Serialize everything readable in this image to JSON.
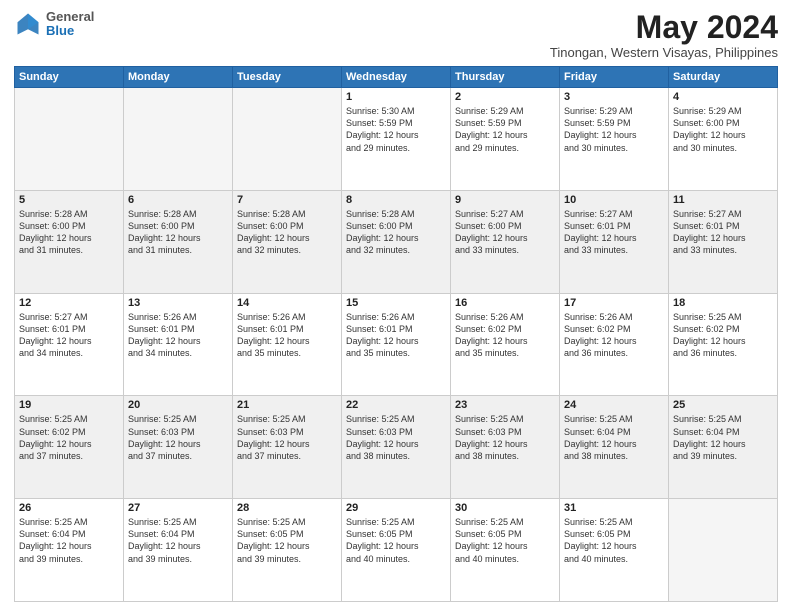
{
  "header": {
    "logo_line1": "General",
    "logo_line2": "Blue",
    "title": "May 2024",
    "subtitle": "Tinongan, Western Visayas, Philippines"
  },
  "columns": [
    "Sunday",
    "Monday",
    "Tuesday",
    "Wednesday",
    "Thursday",
    "Friday",
    "Saturday"
  ],
  "weeks": [
    {
      "shaded": false,
      "days": [
        {
          "num": "",
          "detail": ""
        },
        {
          "num": "",
          "detail": ""
        },
        {
          "num": "",
          "detail": ""
        },
        {
          "num": "1",
          "detail": "Sunrise: 5:30 AM\nSunset: 5:59 PM\nDaylight: 12 hours\nand 29 minutes."
        },
        {
          "num": "2",
          "detail": "Sunrise: 5:29 AM\nSunset: 5:59 PM\nDaylight: 12 hours\nand 29 minutes."
        },
        {
          "num": "3",
          "detail": "Sunrise: 5:29 AM\nSunset: 5:59 PM\nDaylight: 12 hours\nand 30 minutes."
        },
        {
          "num": "4",
          "detail": "Sunrise: 5:29 AM\nSunset: 6:00 PM\nDaylight: 12 hours\nand 30 minutes."
        }
      ]
    },
    {
      "shaded": true,
      "days": [
        {
          "num": "5",
          "detail": "Sunrise: 5:28 AM\nSunset: 6:00 PM\nDaylight: 12 hours\nand 31 minutes."
        },
        {
          "num": "6",
          "detail": "Sunrise: 5:28 AM\nSunset: 6:00 PM\nDaylight: 12 hours\nand 31 minutes."
        },
        {
          "num": "7",
          "detail": "Sunrise: 5:28 AM\nSunset: 6:00 PM\nDaylight: 12 hours\nand 32 minutes."
        },
        {
          "num": "8",
          "detail": "Sunrise: 5:28 AM\nSunset: 6:00 PM\nDaylight: 12 hours\nand 32 minutes."
        },
        {
          "num": "9",
          "detail": "Sunrise: 5:27 AM\nSunset: 6:00 PM\nDaylight: 12 hours\nand 33 minutes."
        },
        {
          "num": "10",
          "detail": "Sunrise: 5:27 AM\nSunset: 6:01 PM\nDaylight: 12 hours\nand 33 minutes."
        },
        {
          "num": "11",
          "detail": "Sunrise: 5:27 AM\nSunset: 6:01 PM\nDaylight: 12 hours\nand 33 minutes."
        }
      ]
    },
    {
      "shaded": false,
      "days": [
        {
          "num": "12",
          "detail": "Sunrise: 5:27 AM\nSunset: 6:01 PM\nDaylight: 12 hours\nand 34 minutes."
        },
        {
          "num": "13",
          "detail": "Sunrise: 5:26 AM\nSunset: 6:01 PM\nDaylight: 12 hours\nand 34 minutes."
        },
        {
          "num": "14",
          "detail": "Sunrise: 5:26 AM\nSunset: 6:01 PM\nDaylight: 12 hours\nand 35 minutes."
        },
        {
          "num": "15",
          "detail": "Sunrise: 5:26 AM\nSunset: 6:01 PM\nDaylight: 12 hours\nand 35 minutes."
        },
        {
          "num": "16",
          "detail": "Sunrise: 5:26 AM\nSunset: 6:02 PM\nDaylight: 12 hours\nand 35 minutes."
        },
        {
          "num": "17",
          "detail": "Sunrise: 5:26 AM\nSunset: 6:02 PM\nDaylight: 12 hours\nand 36 minutes."
        },
        {
          "num": "18",
          "detail": "Sunrise: 5:25 AM\nSunset: 6:02 PM\nDaylight: 12 hours\nand 36 minutes."
        }
      ]
    },
    {
      "shaded": true,
      "days": [
        {
          "num": "19",
          "detail": "Sunrise: 5:25 AM\nSunset: 6:02 PM\nDaylight: 12 hours\nand 37 minutes."
        },
        {
          "num": "20",
          "detail": "Sunrise: 5:25 AM\nSunset: 6:03 PM\nDaylight: 12 hours\nand 37 minutes."
        },
        {
          "num": "21",
          "detail": "Sunrise: 5:25 AM\nSunset: 6:03 PM\nDaylight: 12 hours\nand 37 minutes."
        },
        {
          "num": "22",
          "detail": "Sunrise: 5:25 AM\nSunset: 6:03 PM\nDaylight: 12 hours\nand 38 minutes."
        },
        {
          "num": "23",
          "detail": "Sunrise: 5:25 AM\nSunset: 6:03 PM\nDaylight: 12 hours\nand 38 minutes."
        },
        {
          "num": "24",
          "detail": "Sunrise: 5:25 AM\nSunset: 6:04 PM\nDaylight: 12 hours\nand 38 minutes."
        },
        {
          "num": "25",
          "detail": "Sunrise: 5:25 AM\nSunset: 6:04 PM\nDaylight: 12 hours\nand 39 minutes."
        }
      ]
    },
    {
      "shaded": false,
      "days": [
        {
          "num": "26",
          "detail": "Sunrise: 5:25 AM\nSunset: 6:04 PM\nDaylight: 12 hours\nand 39 minutes."
        },
        {
          "num": "27",
          "detail": "Sunrise: 5:25 AM\nSunset: 6:04 PM\nDaylight: 12 hours\nand 39 minutes."
        },
        {
          "num": "28",
          "detail": "Sunrise: 5:25 AM\nSunset: 6:05 PM\nDaylight: 12 hours\nand 39 minutes."
        },
        {
          "num": "29",
          "detail": "Sunrise: 5:25 AM\nSunset: 6:05 PM\nDaylight: 12 hours\nand 40 minutes."
        },
        {
          "num": "30",
          "detail": "Sunrise: 5:25 AM\nSunset: 6:05 PM\nDaylight: 12 hours\nand 40 minutes."
        },
        {
          "num": "31",
          "detail": "Sunrise: 5:25 AM\nSunset: 6:05 PM\nDaylight: 12 hours\nand 40 minutes."
        },
        {
          "num": "",
          "detail": ""
        }
      ]
    }
  ]
}
